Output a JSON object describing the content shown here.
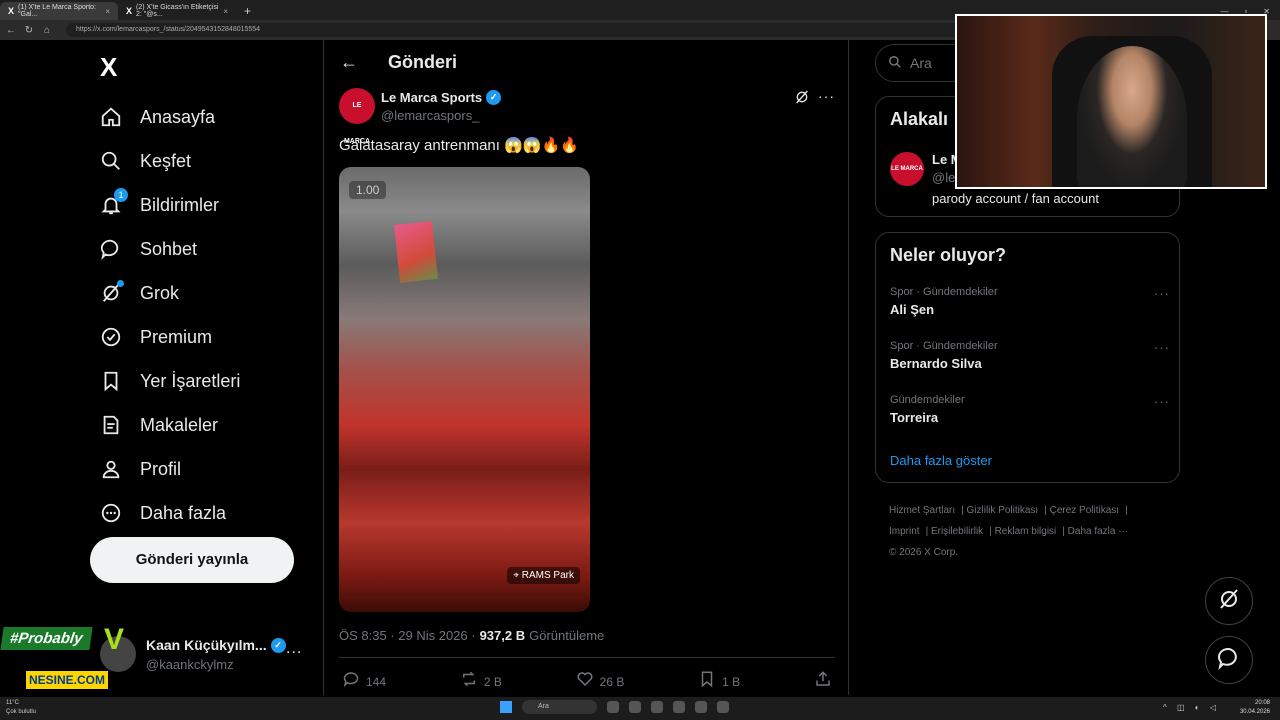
{
  "browser": {
    "tabs": [
      {
        "title": "(1) X'te Le Marca Sporto: \"Gal..."
      },
      {
        "title": "(2) X'te Gicass'ın Etiketçisi 2: \"@s..."
      }
    ],
    "new_tab": "+",
    "url": "https://x.com/lemarcaspors_/status/2049543152848015554"
  },
  "nav": {
    "logo": "X",
    "items": [
      {
        "label": "Anasayfa",
        "icon": "home-icon"
      },
      {
        "label": "Keşfet",
        "icon": "search-icon"
      },
      {
        "label": "Bildirimler",
        "icon": "bell-icon",
        "badge": "1"
      },
      {
        "label": "Sohbet",
        "icon": "chat-icon"
      },
      {
        "label": "Grok",
        "icon": "grok-icon"
      },
      {
        "label": "Premium",
        "icon": "premium-icon"
      },
      {
        "label": "Yer İşaretleri",
        "icon": "bookmark-icon"
      },
      {
        "label": "Makaleler",
        "icon": "article-icon"
      },
      {
        "label": "Profil",
        "icon": "person-icon"
      },
      {
        "label": "Daha fazla",
        "icon": "more-circle-icon"
      }
    ],
    "post_button": "Gönderi yayınla",
    "account": {
      "name": "Kaan Küçükyılm...",
      "handle": "@kaankckylmz",
      "more": "..."
    }
  },
  "promo": {
    "hashtag": "#Probably",
    "brand": "NESINE.COM"
  },
  "post": {
    "header_title": "Gönderi",
    "author_name": "Le Marca Sports",
    "author_handle": "@lemarcaspors_",
    "avatar_text": "LE MARCA",
    "text": "Galatasaray antrenmanı 😱😱🔥🔥",
    "media": {
      "speed": "1.00",
      "location": "RAMS Park"
    },
    "time": "ÖS 8:35 · 29 Nis 2026 ·",
    "views": "937,2 B",
    "views_label": "Görüntüleme",
    "stats": {
      "replies": "144",
      "reposts": "2 B",
      "likes": "26 B",
      "bookmarks": "1 B"
    }
  },
  "right": {
    "search_placeholder": "Ara",
    "related": {
      "title": "Alakalı",
      "name": "Le M",
      "handle": "@le",
      "bio": "parody account / fan account",
      "avatar_text": "LE MARCA"
    },
    "trends": {
      "title": "Neler oluyor?",
      "items": [
        {
          "category": "Spor · Gündemdekiler",
          "name": "Ali Şen"
        },
        {
          "category": "Spor · Gündemdekiler",
          "name": "Bernardo Silva"
        },
        {
          "category": "Gündemdekiler",
          "name": "Torreira"
        }
      ],
      "show_more": "Daha fazla göster"
    },
    "footer": {
      "links": [
        "Hizmet Şartları",
        "Gizlilik Politikası",
        "Çerez Politikası",
        "Imprint",
        "Erişilebilirlik",
        "Reklam bilgisi",
        "Daha fazla ···"
      ],
      "copyright": "© 2026 X Corp."
    }
  },
  "taskbar": {
    "temp": "11°C",
    "weather": "Çok bulutlu",
    "search": "Ara",
    "time": "20:08",
    "date": "30.04.2026"
  },
  "colors": {
    "accent": "#1d9bf0",
    "background": "#000000",
    "border": "#2f3336",
    "secondary_text": "#71767b"
  }
}
